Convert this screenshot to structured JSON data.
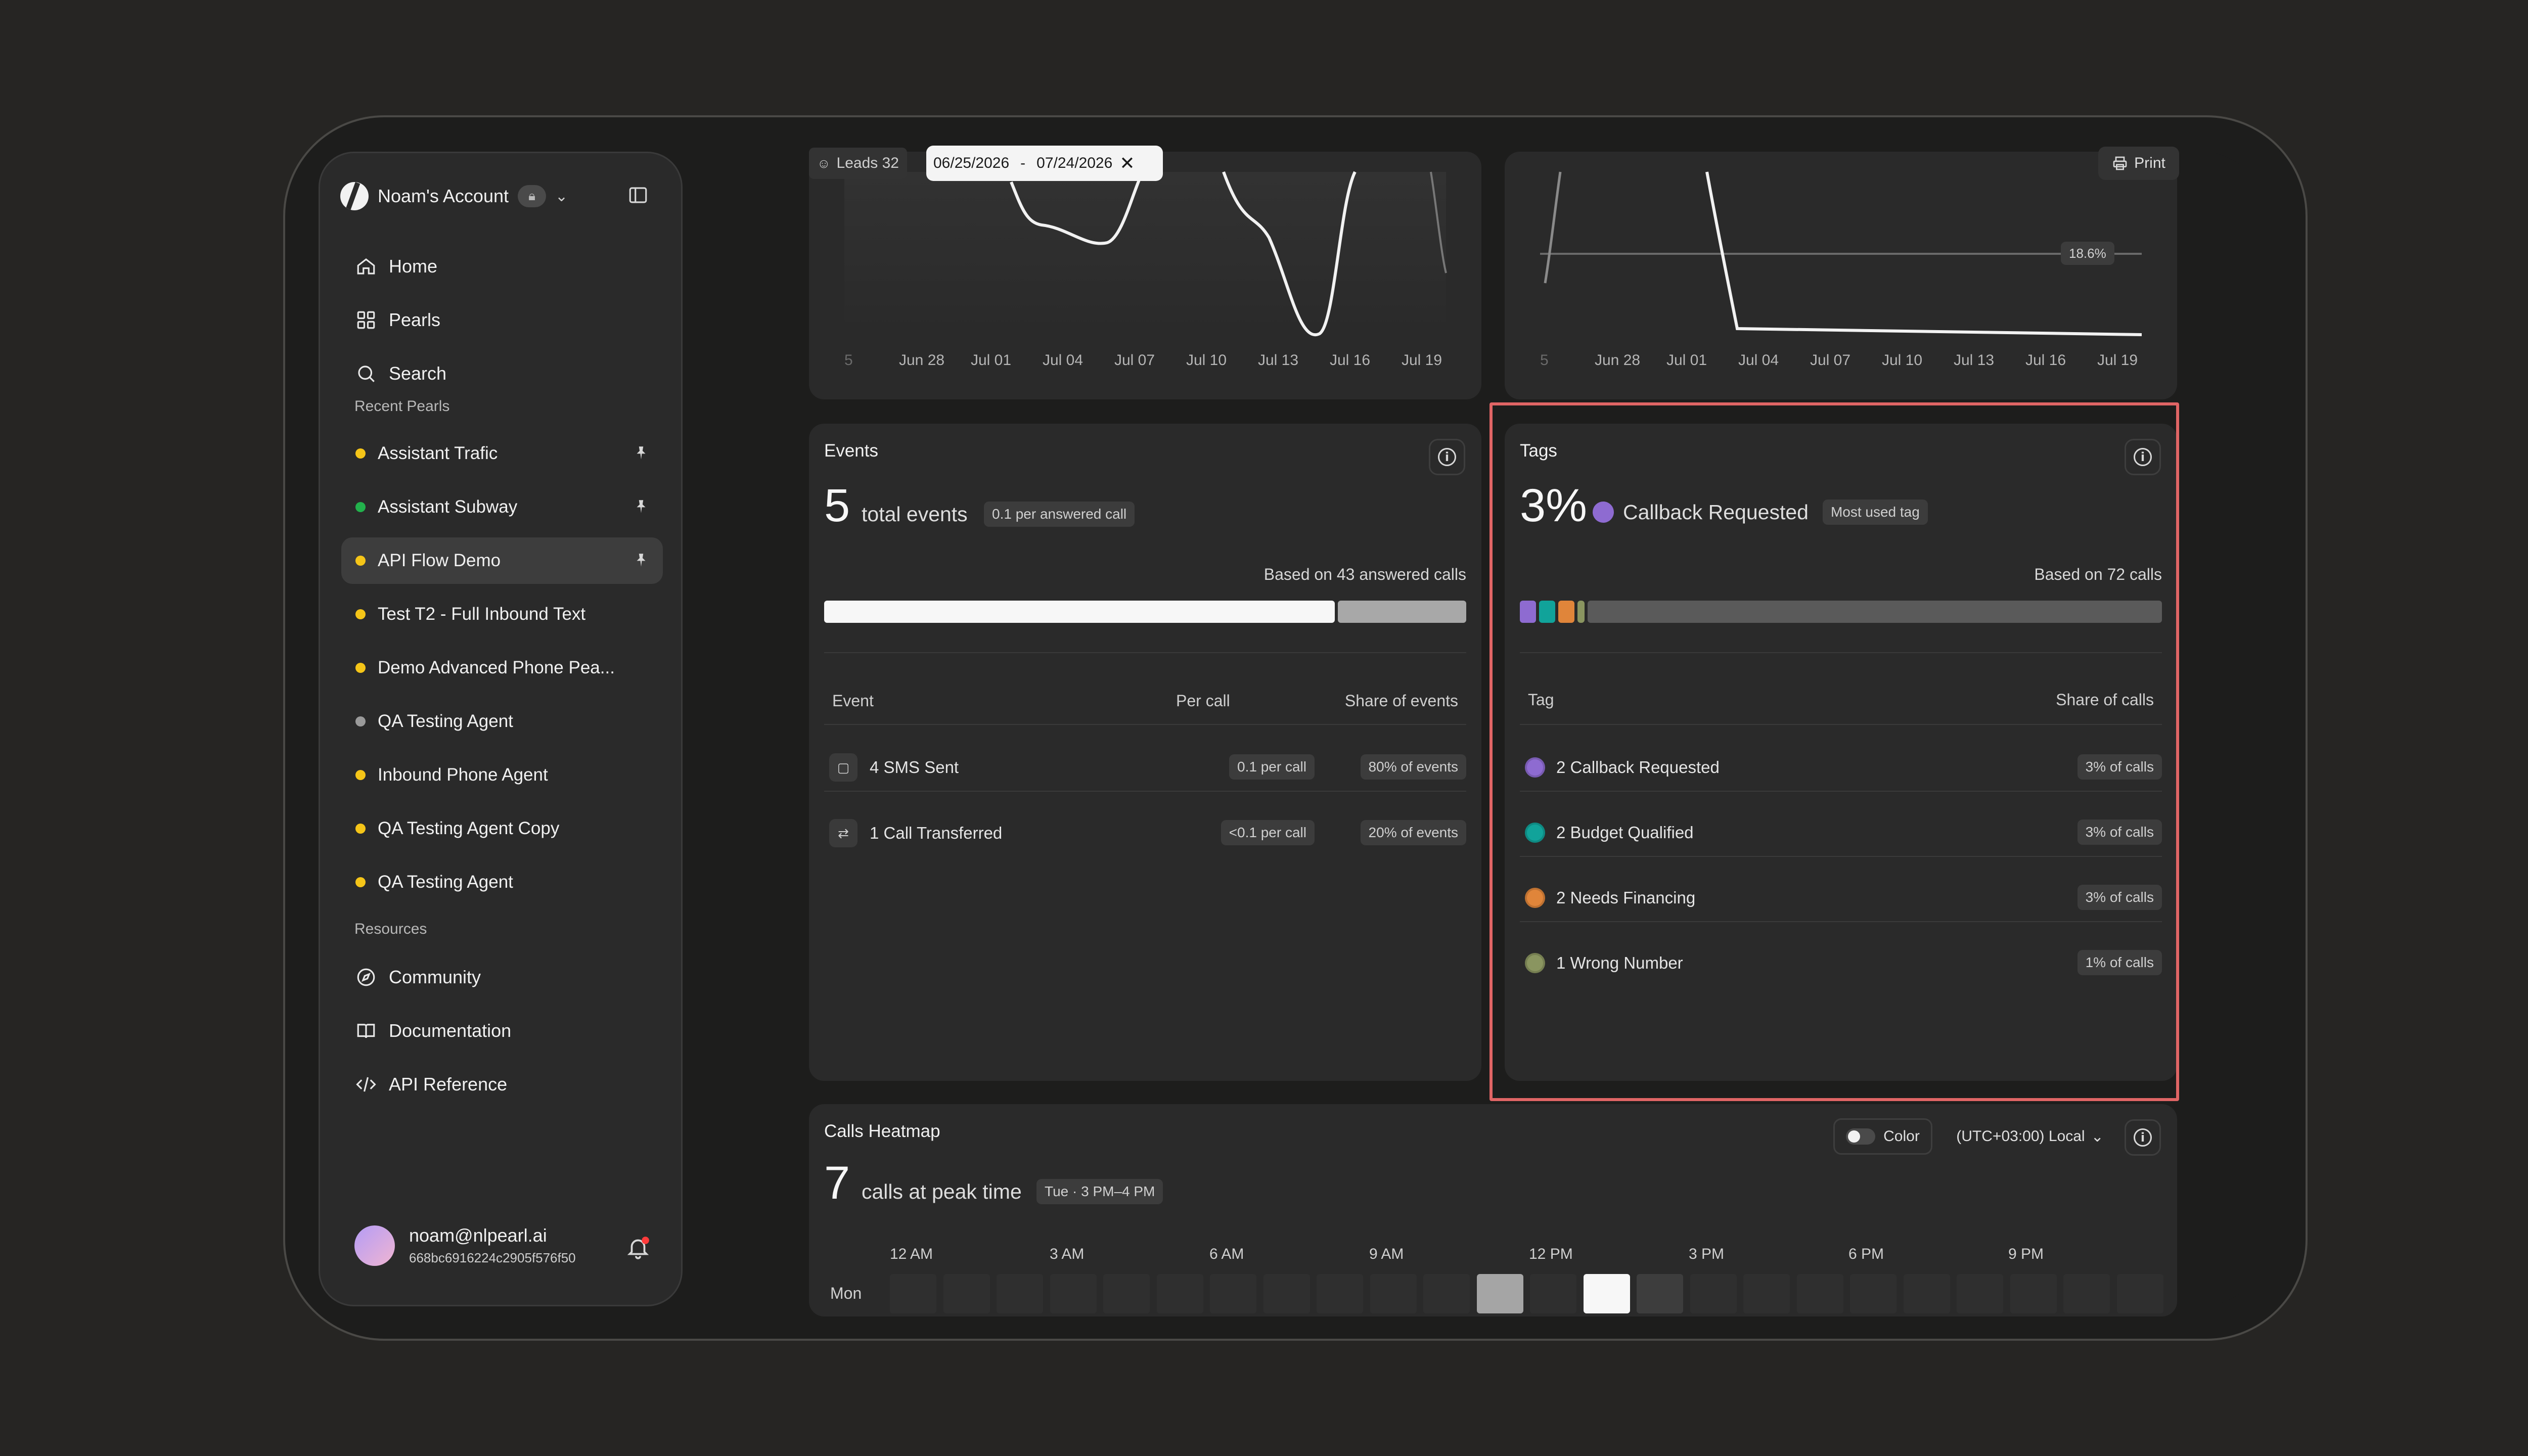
{
  "sidebar": {
    "account_name": "Noam's Account",
    "nav": [
      {
        "label": "Home",
        "icon": "home-icon"
      },
      {
        "label": "Pearls",
        "icon": "grid-icon"
      },
      {
        "label": "Search",
        "icon": "search-icon"
      }
    ],
    "recent_label": "Recent Pearls",
    "pearls": [
      {
        "label": "Assistant Trafic",
        "color": "#f5c518",
        "pinned": true
      },
      {
        "label": "Assistant Subway",
        "color": "#22b14c",
        "pinned": true
      },
      {
        "label": "API Flow Demo",
        "color": "#f5c518",
        "pinned": true,
        "active": true
      },
      {
        "label": "Test T2 - Full Inbound Text",
        "color": "#f5c518"
      },
      {
        "label": "Demo Advanced Phone Pea...",
        "color": "#f5c518"
      },
      {
        "label": "QA Testing Agent",
        "color": "#9a9a9a"
      },
      {
        "label": "Inbound Phone Agent",
        "color": "#f5c518"
      },
      {
        "label": "QA Testing Agent Copy",
        "color": "#f5c518"
      },
      {
        "label": "QA Testing Agent",
        "color": "#f5c518"
      }
    ],
    "resources_label": "Resources",
    "resources": [
      {
        "label": "Community",
        "icon": "compass-icon"
      },
      {
        "label": "Documentation",
        "icon": "book-icon"
      },
      {
        "label": "API Reference",
        "icon": "code-icon"
      }
    ],
    "user": {
      "email": "noam@nlpearl.ai",
      "id": "668bc6916224c2905f576f50"
    }
  },
  "toolbar": {
    "leads_label": "Leads 32",
    "date_start": "06/25/2026",
    "date_sep": "-",
    "date_end": "07/24/2026",
    "print_label": "Print"
  },
  "charts": {
    "left_ticks": [
      "5",
      "Jun 28",
      "Jul 01",
      "Jul 04",
      "Jul 07",
      "Jul 10",
      "Jul 13",
      "Jul 16",
      "Jul 19"
    ],
    "right_ticks": [
      "5",
      "Jun 28",
      "Jul 01",
      "Jul 04",
      "Jul 07",
      "Jul 10",
      "Jul 13",
      "Jul 16",
      "Jul 19"
    ],
    "right_ref_label": "18.6%"
  },
  "events": {
    "title": "Events",
    "total": "5",
    "total_label": "total events",
    "per_call_pill": "0.1 per answered call",
    "based_on": "Based on 43 answered calls",
    "bar_share": 0.8,
    "headers": {
      "event": "Event",
      "per_call": "Per call",
      "share": "Share of events"
    },
    "rows": [
      {
        "label": "4 SMS Sent",
        "per_call": "0.1 per call",
        "share": "80% of events",
        "icon": "message-icon"
      },
      {
        "label": "1 Call Transferred",
        "per_call": "<0.1 per call",
        "share": "20% of events",
        "icon": "transfer-icon"
      }
    ]
  },
  "tags": {
    "title": "Tags",
    "percent": "3%",
    "top_tag": "Callback Requested",
    "top_tag_color": "#8e6bd1",
    "most_used_pill": "Most used tag",
    "based_on": "Based on 72 calls",
    "headers": {
      "tag": "Tag",
      "share": "Share of calls"
    },
    "rows": [
      {
        "label": "2 Callback Requested",
        "share": "3% of calls",
        "color": "#8e6bd1"
      },
      {
        "label": "2 Budget Qualified",
        "share": "3% of calls",
        "color": "#11a39a"
      },
      {
        "label": "2 Needs Financing",
        "share": "3% of calls",
        "color": "#e0853a"
      },
      {
        "label": "1 Wrong Number",
        "share": "1% of calls",
        "color": "#8a9560"
      }
    ]
  },
  "heatmap": {
    "title": "Calls Heatmap",
    "color_toggle_label": "Color",
    "timezone": "(UTC+03:00) Local",
    "peak_value": "7",
    "peak_label": "calls at peak time",
    "peak_pill": "Tue · 3 PM–4 PM",
    "hours": [
      "12 AM",
      "3 AM",
      "6 AM",
      "9 AM",
      "12 PM",
      "3 PM",
      "6 PM",
      "9 PM"
    ],
    "row_label": "Mon",
    "mon_levels": [
      0,
      0,
      0,
      0,
      0,
      0,
      0,
      0,
      0,
      0,
      0,
      0.6,
      0,
      1,
      0.1,
      0,
      0,
      0,
      0,
      0,
      0,
      0,
      0,
      0
    ]
  }
}
